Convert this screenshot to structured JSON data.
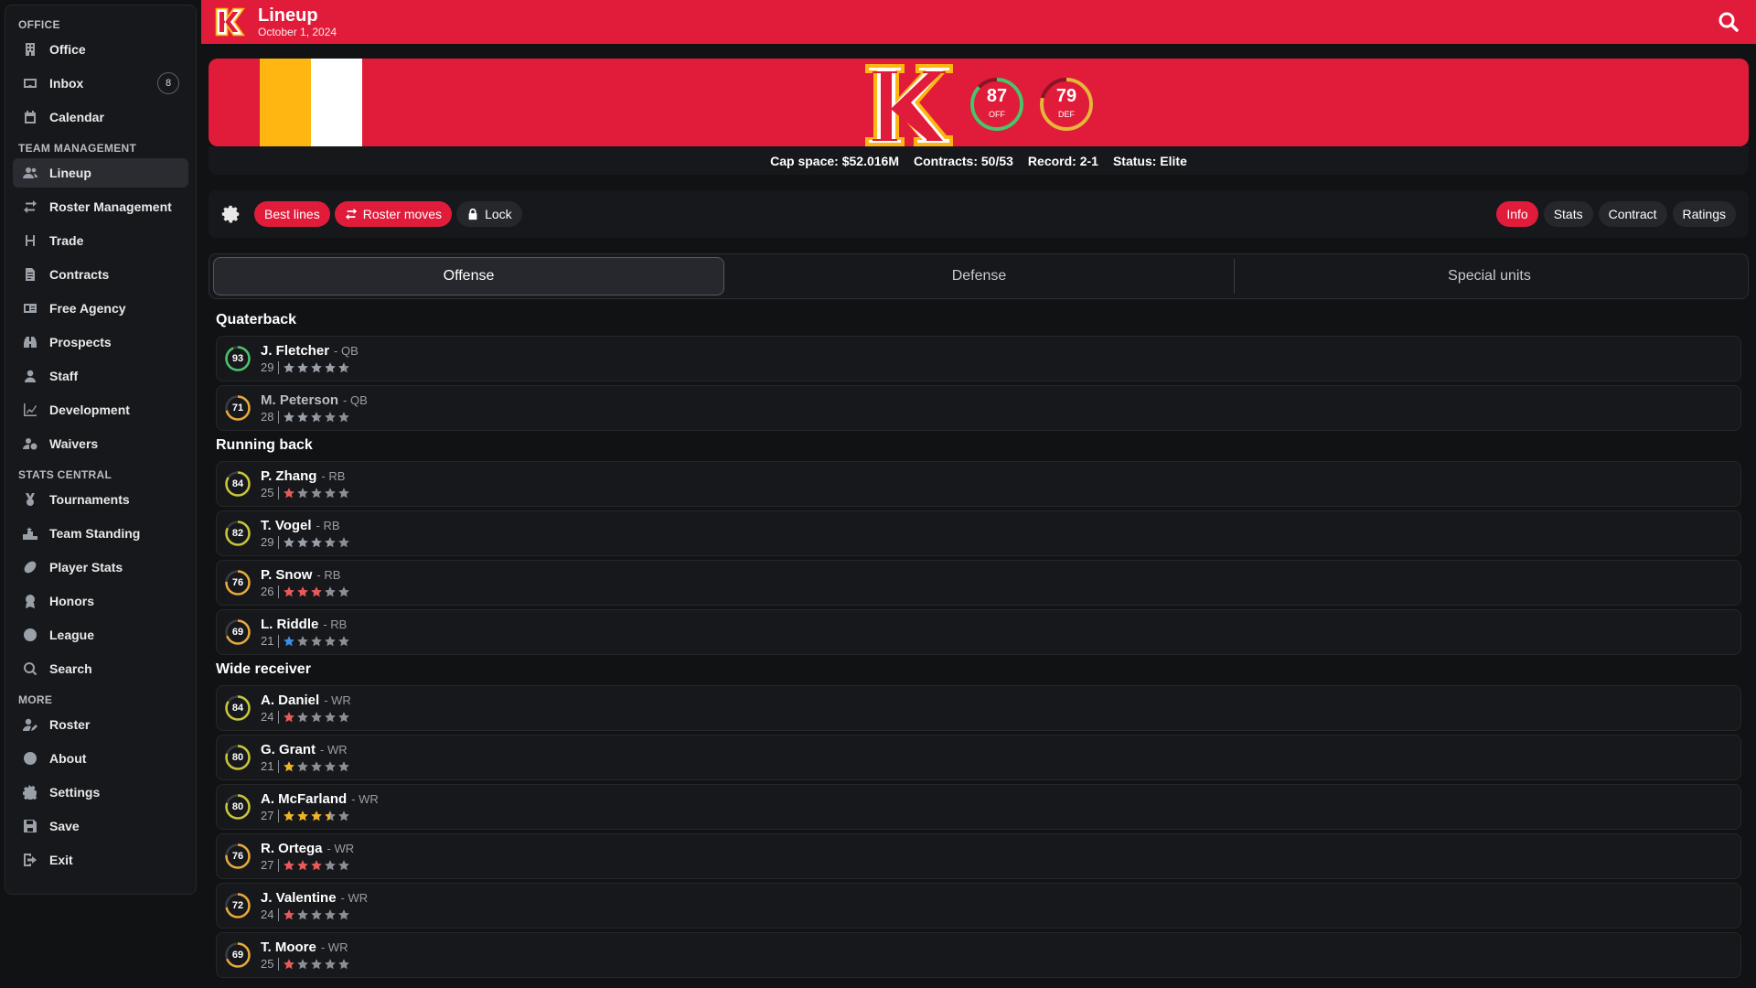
{
  "sidebar": {
    "sections": [
      {
        "title": "OFFICE",
        "items": [
          {
            "label": "Office",
            "icon": "building-icon"
          },
          {
            "label": "Inbox",
            "icon": "inbox-icon",
            "badge": "8"
          },
          {
            "label": "Calendar",
            "icon": "calendar-icon"
          }
        ]
      },
      {
        "title": "TEAM MANAGEMENT",
        "items": [
          {
            "label": "Lineup",
            "icon": "users-icon",
            "active": true
          },
          {
            "label": "Roster Management",
            "icon": "swap-icon"
          },
          {
            "label": "Trade",
            "icon": "trade-icon"
          },
          {
            "label": "Contracts",
            "icon": "contract-icon"
          },
          {
            "label": "Free Agency",
            "icon": "id-card-icon"
          },
          {
            "label": "Prospects",
            "icon": "binoculars-icon"
          },
          {
            "label": "Staff",
            "icon": "person-icon"
          },
          {
            "label": "Development",
            "icon": "chart-line-icon"
          },
          {
            "label": "Waivers",
            "icon": "user-clock-icon"
          }
        ]
      },
      {
        "title": "STATS CENTRAL",
        "items": [
          {
            "label": "Tournaments",
            "icon": "medal-icon"
          },
          {
            "label": "Team Standing",
            "icon": "podium-icon"
          },
          {
            "label": "Player Stats",
            "icon": "ball-icon"
          },
          {
            "label": "Honors",
            "icon": "award-icon"
          },
          {
            "label": "League",
            "icon": "globe-icon"
          },
          {
            "label": "Search",
            "icon": "search-icon"
          }
        ]
      },
      {
        "title": "MORE",
        "items": [
          {
            "label": "Roster",
            "icon": "user-edit-icon"
          },
          {
            "label": "About",
            "icon": "info-icon"
          },
          {
            "label": "Settings",
            "icon": "gear-icon"
          },
          {
            "label": "Save",
            "icon": "save-icon"
          },
          {
            "label": "Exit",
            "icon": "exit-icon"
          }
        ]
      }
    ]
  },
  "header": {
    "title": "Lineup",
    "date": "October 1, 2024"
  },
  "team": {
    "colors": {
      "primary": "#e01c3a",
      "stripe1": "#ffb612",
      "stripe2": "#ffffff"
    },
    "off_rating": "87",
    "off_label": "OFF",
    "def_rating": "79",
    "def_label": "DEF",
    "cap_space": "Cap space: $52.016M",
    "contracts": "Contracts: 50/53",
    "record": "Record: 2-1",
    "status": "Status: Elite"
  },
  "toolbar": {
    "best_lines": "Best lines",
    "roster_moves": "Roster moves",
    "lock": "Lock",
    "views": [
      "Info",
      "Stats",
      "Contract",
      "Ratings"
    ],
    "active_view": "Info"
  },
  "tabs": [
    "Offense",
    "Defense",
    "Special units"
  ],
  "active_tab": "Offense",
  "groups": [
    {
      "title": "Quaterback",
      "players": [
        {
          "name": "J. Fletcher",
          "pos": "QB",
          "age": "29",
          "ovr": 93,
          "stars": 4.5,
          "star_color": "#9aa0a8",
          "dim": false
        },
        {
          "name": "M. Peterson",
          "pos": "QB",
          "age": "28",
          "ovr": 71,
          "stars": 2.5,
          "star_color": "#9aa0a8",
          "dim": true
        }
      ]
    },
    {
      "title": "Running back",
      "players": [
        {
          "name": "P. Zhang",
          "pos": "RB",
          "age": "25",
          "ovr": 84,
          "stars": 1,
          "star_color": "#e85a5a",
          "dim": false
        },
        {
          "name": "T. Vogel",
          "pos": "RB",
          "age": "29",
          "ovr": 82,
          "stars": 3.5,
          "star_color": "#9aa0a8",
          "dim": false
        },
        {
          "name": "P. Snow",
          "pos": "RB",
          "age": "26",
          "ovr": 76,
          "stars": 3,
          "star_color": "#e85a5a",
          "dim": false
        },
        {
          "name": "L. Riddle",
          "pos": "RB",
          "age": "21",
          "ovr": 69,
          "stars": 1,
          "star_color": "#3a8ee6",
          "dim": false
        }
      ]
    },
    {
      "title": "Wide receiver",
      "players": [
        {
          "name": "A. Daniel",
          "pos": "WR",
          "age": "24",
          "ovr": 84,
          "stars": 1,
          "star_color": "#e85a5a",
          "dim": false
        },
        {
          "name": "G. Grant",
          "pos": "WR",
          "age": "21",
          "ovr": 80,
          "stars": 1,
          "star_color": "#f0b429",
          "dim": false
        },
        {
          "name": "A. McFarland",
          "pos": "WR",
          "age": "27",
          "ovr": 80,
          "stars": 3.5,
          "star_color": "#f0b429",
          "dim": false
        },
        {
          "name": "R. Ortega",
          "pos": "WR",
          "age": "27",
          "ovr": 76,
          "stars": 3,
          "star_color": "#e85a5a",
          "dim": false
        },
        {
          "name": "J. Valentine",
          "pos": "WR",
          "age": "24",
          "ovr": 72,
          "stars": 1,
          "star_color": "#e85a5a",
          "dim": false
        },
        {
          "name": "T. Moore",
          "pos": "WR",
          "age": "25",
          "ovr": 69,
          "stars": 1,
          "star_color": "#e85a5a",
          "dim": false
        }
      ]
    }
  ]
}
